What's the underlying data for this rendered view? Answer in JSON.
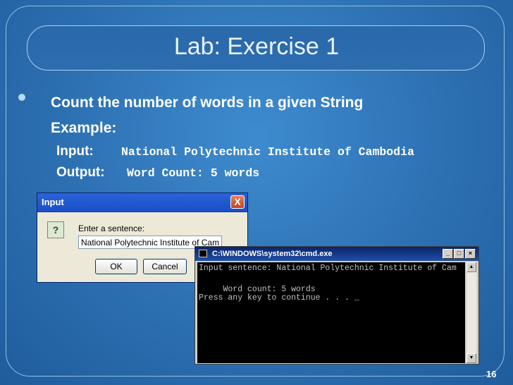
{
  "slide": {
    "title": "Lab: Exercise 1",
    "bullet": "Count the number of words in a given String",
    "example_label": "Example:",
    "input_label": "Input:",
    "input_value": "National Polytechnic Institute of Cambodia",
    "output_label": "Output:",
    "output_value": "Word Count: 5 words",
    "page_number": "16"
  },
  "input_dialog": {
    "title": "Input",
    "close_glyph": "X",
    "icon_glyph": "?",
    "prompt": "Enter a sentence:",
    "field_value": "National Polytechnic Institute of Cam",
    "ok_label": "OK",
    "cancel_label": "Cancel"
  },
  "cmd_window": {
    "title": "C:\\WINDOWS\\system32\\cmd.exe",
    "lines": [
      "Input sentence: National Polytechnic Institute of Cam",
      "",
      "     Word count: 5 words",
      "Press any key to continue . . . _"
    ]
  },
  "colors": {
    "background": "#2f74b6",
    "title_text": "#eaf3ff",
    "console_text": "#c0c0c0"
  }
}
